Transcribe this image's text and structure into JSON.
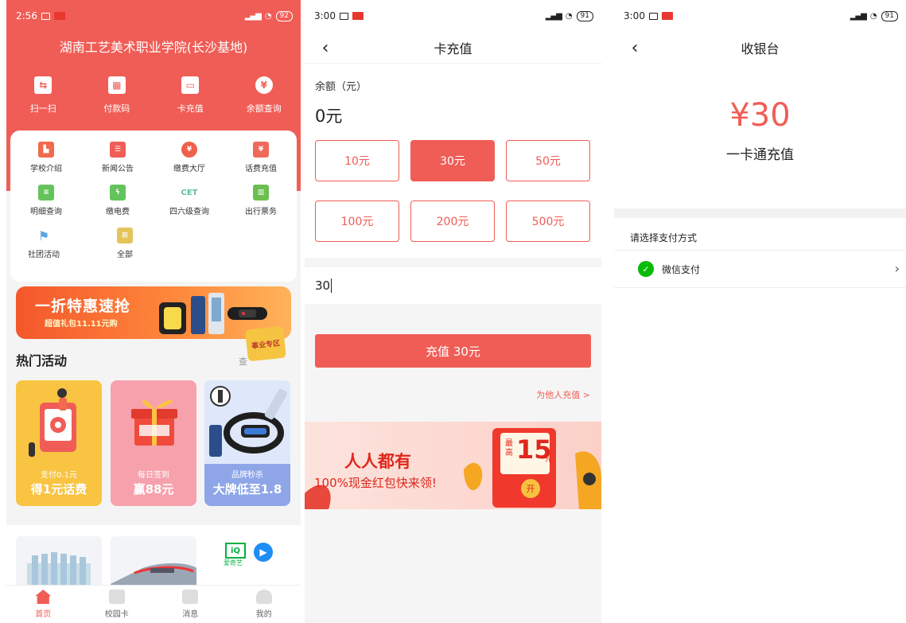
{
  "screen1": {
    "status_time": "2:56",
    "battery": "92",
    "campus_title": "湖南工艺美术职业学院(长沙基地)",
    "top_actions": [
      {
        "label": "扫一扫",
        "icon": "scan-icon"
      },
      {
        "label": "付款码",
        "icon": "qr-code-icon"
      },
      {
        "label": "卡充值",
        "icon": "card-recharge-icon"
      },
      {
        "label": "余额查询",
        "icon": "balance-bag-icon"
      }
    ],
    "menu_items": [
      {
        "label": "学校介绍",
        "icon": "school-icon",
        "color": "#f06a4d"
      },
      {
        "label": "新闻公告",
        "icon": "news-icon",
        "color": "#f05d56"
      },
      {
        "label": "缴费大厅",
        "icon": "payment-hall-icon",
        "color": "#f0614b"
      },
      {
        "label": "话费充值",
        "icon": "phone-recharge-icon",
        "color": "#f06a5c"
      },
      {
        "label": "明细查询",
        "icon": "details-icon",
        "color": "#66c35b"
      },
      {
        "label": "缴电费",
        "icon": "lightning-icon",
        "color": "#63c35c"
      },
      {
        "label": "四六级查询",
        "icon": "cet-icon",
        "color": "#5cc19a"
      },
      {
        "label": "出行票务",
        "icon": "luggage-icon",
        "color": "#6bbf4e"
      },
      {
        "label": "社团活动",
        "icon": "flag-icon",
        "color": "#5ca4e6"
      },
      {
        "label": "全部",
        "icon": "grid-icon",
        "color": "#e6c45c"
      }
    ],
    "cet_text": "CET",
    "promo_title": "一折特惠速抢",
    "promo_sub": "超值礼包11.11元购",
    "promo_tag": "事业专区",
    "hot_title": "热门活动",
    "hot_more": "查",
    "activities": [
      {
        "label1": "支付0.1元",
        "label2": "得1元话费",
        "color": "#f9c442"
      },
      {
        "label1": "每日签到",
        "label2": "赢88元",
        "color": "#f7a1ad"
      },
      {
        "label1": "品牌秒杀",
        "label2": "大牌低至1.8",
        "color": "#8ea6e8"
      }
    ],
    "iqiyi_text": "爱奇艺",
    "tabs": [
      {
        "label": "首页",
        "icon": "home-icon",
        "active": true
      },
      {
        "label": "校园卡",
        "icon": "campus-card-icon",
        "active": false
      },
      {
        "label": "消息",
        "icon": "message-icon",
        "active": false
      },
      {
        "label": "我的",
        "icon": "profile-icon",
        "active": false
      }
    ]
  },
  "screen2": {
    "status_time": "3:00",
    "battery": "91",
    "title": "卡充值",
    "balance_label": "余额（元）",
    "balance_value": "0元",
    "amounts": [
      "10元",
      "30元",
      "50元",
      "100元",
      "200元",
      "500元"
    ],
    "selected_amount": "30元",
    "custom_value": "30",
    "charge_button": "充值 30元",
    "other_link": "为他人充值 >",
    "red_packet": {
      "title": "人人都有",
      "subtitle": "100%现金红包快来领!",
      "zui_gao": "最高",
      "amount": "15",
      "unit": "元",
      "open": "开"
    }
  },
  "screen3": {
    "status_time": "3:00",
    "battery": "91",
    "title": "收银台",
    "amount": "¥30",
    "description": "一卡通充值",
    "pay_method_label": "请选择支付方式",
    "pay_option": "微信支付"
  }
}
